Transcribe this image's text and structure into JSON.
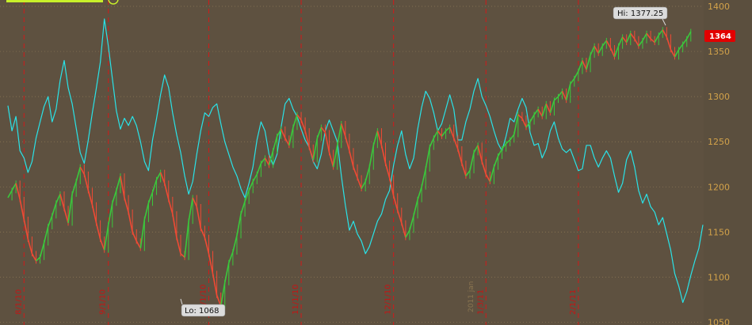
{
  "chart_data": {
    "type": "line",
    "title": "",
    "ylim": [
      1047,
      1407
    ],
    "y_ticks": [
      1400,
      1350,
      1300,
      1250,
      1200,
      1150,
      1100,
      1050
    ],
    "date_labels": [
      "8/1/10",
      "9/1/10",
      "10/1/10",
      "11/1/10",
      "12/1/10",
      "1/3/11",
      "2/1/11"
    ],
    "faint_label": "2011 jan",
    "grid": true,
    "current_price": "1364",
    "hi_label": "Hi: 1377.25",
    "lo_label": "Lo: 1068",
    "series": [
      {
        "name": "",
        "color": "#29e3e8",
        "values": [
          1290,
          1262,
          1278,
          1240,
          1232,
          1216,
          1228,
          1254,
          1272,
          1289,
          1300,
          1272,
          1286,
          1318,
          1340,
          1310,
          1292,
          1265,
          1238,
          1226,
          1252,
          1282,
          1309,
          1338,
          1386,
          1356,
          1320,
          1284,
          1264,
          1276,
          1268,
          1278,
          1268,
          1250,
          1228,
          1218,
          1252,
          1276,
          1302,
          1324,
          1310,
          1282,
          1258,
          1238,
          1212,
          1192,
          1206,
          1236,
          1262,
          1282,
          1278,
          1288,
          1292,
          1270,
          1250,
          1236,
          1222,
          1212,
          1198,
          1188,
          1204,
          1222,
          1252,
          1272,
          1262,
          1236,
          1224,
          1236,
          1266,
          1292,
          1298,
          1286,
          1278,
          1264,
          1252,
          1244,
          1228,
          1220,
          1236,
          1262,
          1274,
          1262,
          1250,
          1212,
          1180,
          1152,
          1162,
          1148,
          1140,
          1126,
          1134,
          1148,
          1162,
          1170,
          1186,
          1196,
          1224,
          1246,
          1262,
          1236,
          1220,
          1232,
          1264,
          1288,
          1306,
          1298,
          1282,
          1262,
          1270,
          1286,
          1302,
          1286,
          1252,
          1252,
          1272,
          1286,
          1306,
          1320,
          1300,
          1290,
          1278,
          1262,
          1248,
          1240,
          1256,
          1276,
          1272,
          1286,
          1298,
          1288,
          1260,
          1246,
          1248,
          1232,
          1242,
          1262,
          1272,
          1254,
          1242,
          1238,
          1242,
          1230,
          1218,
          1220,
          1246,
          1246,
          1232,
          1222,
          1232,
          1240,
          1232,
          1212,
          1194,
          1204,
          1230,
          1240,
          1222,
          1196,
          1182,
          1192,
          1178,
          1172,
          1158,
          1166,
          1148,
          1130,
          1104,
          1090,
          1072,
          1084,
          1102,
          1118,
          1132,
          1158
        ]
      },
      {
        "name": "",
        "color": "#38c83a",
        "values": [
          1188,
          1196,
          1204,
          1186,
          1164,
          1142,
          1126,
          1118,
          1122,
          1138,
          1156,
          1168,
          1182,
          1192,
          1176,
          1160,
          1192,
          1206,
          1222,
          1214,
          1196,
          1180,
          1160,
          1142,
          1130,
          1158,
          1182,
          1196,
          1212,
          1188,
          1172,
          1150,
          1140,
          1132,
          1164,
          1182,
          1194,
          1208,
          1216,
          1204,
          1186,
          1170,
          1144,
          1126,
          1122,
          1162,
          1188,
          1178,
          1154,
          1144,
          1126,
          1104,
          1080,
          1068,
          1094,
          1116,
          1128,
          1146,
          1170,
          1184,
          1196,
          1206,
          1214,
          1226,
          1232,
          1224,
          1240,
          1256,
          1264,
          1254,
          1246,
          1266,
          1280,
          1274,
          1262,
          1244,
          1230,
          1254,
          1266,
          1260,
          1238,
          1222,
          1246,
          1270,
          1256,
          1240,
          1222,
          1210,
          1198,
          1206,
          1222,
          1246,
          1262,
          1246,
          1226,
          1210,
          1190,
          1174,
          1160,
          1144,
          1152,
          1168,
          1186,
          1200,
          1220,
          1244,
          1254,
          1262,
          1256,
          1262,
          1266,
          1254,
          1242,
          1226,
          1212,
          1218,
          1238,
          1246,
          1228,
          1214,
          1206,
          1222,
          1234,
          1242,
          1248,
          1252,
          1258,
          1280,
          1276,
          1266,
          1272,
          1280,
          1286,
          1278,
          1292,
          1282,
          1296,
          1300,
          1306,
          1296,
          1314,
          1320,
          1328,
          1340,
          1330,
          1346,
          1356,
          1348,
          1356,
          1362,
          1354,
          1344,
          1356,
          1366,
          1360,
          1370,
          1364,
          1356,
          1362,
          1370,
          1364,
          1360,
          1368,
          1374,
          1366,
          1352,
          1344,
          1352,
          1358,
          1364,
          1372
        ]
      }
    ]
  }
}
